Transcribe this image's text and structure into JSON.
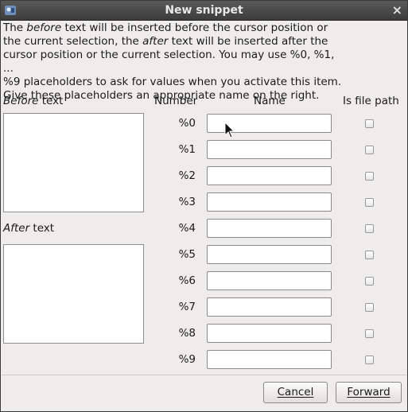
{
  "window": {
    "title": "New snippet",
    "close_glyph": "×"
  },
  "description": {
    "line1_a": "The ",
    "line1_em": "before",
    "line1_b": " text will be inserted before the cursor position or",
    "line2_a": "the current selection, the ",
    "line2_em": "after",
    "line2_b": " text will be inserted after the",
    "line3": "cursor position or the current selection. You may use %0, %1, ...",
    "line4": "%9 placeholders to ask for values when you activate this item.",
    "line5": "Give these placeholders an appropriate name on the right."
  },
  "before_label": {
    "em": "Before",
    "rest": " text"
  },
  "after_label": {
    "em": "After",
    "rest": " text"
  },
  "headers": {
    "number": "Number",
    "name": "Name",
    "file_path": "Is file path"
  },
  "placeholders": [
    {
      "number": "%0",
      "name": "",
      "is_file_path": false
    },
    {
      "number": "%1",
      "name": "",
      "is_file_path": false
    },
    {
      "number": "%2",
      "name": "",
      "is_file_path": false
    },
    {
      "number": "%3",
      "name": "",
      "is_file_path": false
    },
    {
      "number": "%4",
      "name": "",
      "is_file_path": false
    },
    {
      "number": "%5",
      "name": "",
      "is_file_path": false
    },
    {
      "number": "%6",
      "name": "",
      "is_file_path": false
    },
    {
      "number": "%7",
      "name": "",
      "is_file_path": false
    },
    {
      "number": "%8",
      "name": "",
      "is_file_path": false
    },
    {
      "number": "%9",
      "name": "",
      "is_file_path": false
    }
  ],
  "buttons": {
    "cancel": "Cancel",
    "forward": "Forward"
  },
  "icons": {
    "app": "app-logo-icon",
    "close": "close-icon",
    "pointer": "mouse-pointer-icon"
  }
}
